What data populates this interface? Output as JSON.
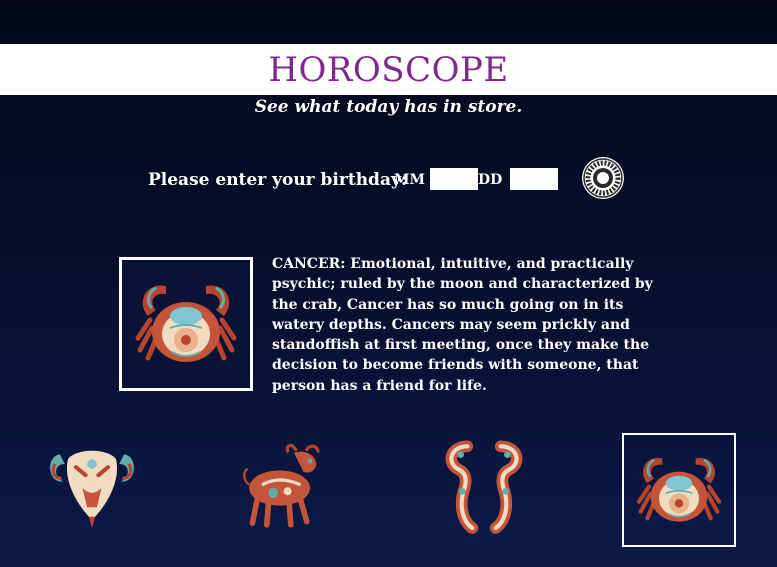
{
  "header": {
    "title": "HOROSCOPE"
  },
  "subtitle": "See what today has in store.",
  "birthday_form": {
    "prompt": "Please enter your birthday:",
    "month_label": "MM",
    "month_value": "",
    "day_label": "DD",
    "day_value": "",
    "submit_icon": "zodiac-wheel-icon"
  },
  "featured_sign": {
    "icon": "cancer-crab-icon",
    "description": "CANCER: Emotional, intuitive, and practically psychic; ruled by the moon and characterized by the crab, Cancer has so much going on in its watery depths. Cancers may seem prickly and standoffish at first meeting, once they make the decision to become friends with someone, that person has a friend for life."
  },
  "signs": [
    {
      "icon": "aries-ram-icon",
      "selected": false
    },
    {
      "icon": "taurus-bull-icon",
      "selected": false
    },
    {
      "icon": "gemini-twins-icon",
      "selected": false
    },
    {
      "icon": "cancer-crab-icon",
      "selected": true
    }
  ],
  "colors": {
    "title": "#7d2a8c",
    "background_top": "#04081a",
    "background_bottom": "#0d1a48",
    "sign_teal": "#5fb0a8",
    "sign_rust": "#b5452d",
    "sign_cream": "#f1dcc1"
  }
}
